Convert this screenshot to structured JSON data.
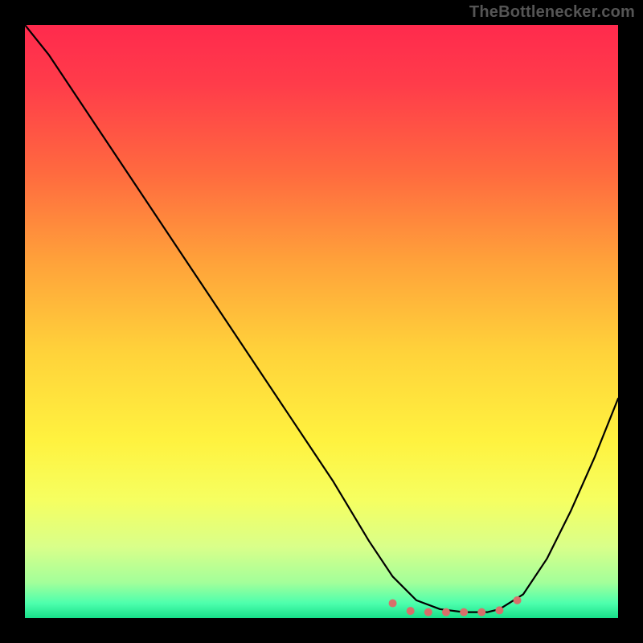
{
  "watermark": "TheBottlenecker.com",
  "chart_data": {
    "type": "line",
    "title": "",
    "xlabel": "",
    "ylabel": "",
    "xlim": [
      0,
      100
    ],
    "ylim": [
      0,
      100
    ],
    "series": [
      {
        "name": "curve",
        "x": [
          0,
          4,
          12,
          20,
          28,
          36,
          44,
          52,
          58,
          62,
          66,
          70,
          74,
          78,
          80,
          84,
          88,
          92,
          96,
          100
        ],
        "y": [
          100,
          95,
          83,
          71,
          59,
          47,
          35,
          23,
          13,
          7,
          3,
          1.5,
          1.0,
          1.0,
          1.5,
          4,
          10,
          18,
          27,
          37
        ]
      }
    ],
    "markers": {
      "name": "highlight-dots",
      "color": "#d86f6a",
      "points": [
        {
          "x": 62,
          "y": 2.5
        },
        {
          "x": 65,
          "y": 1.2
        },
        {
          "x": 68,
          "y": 1.0
        },
        {
          "x": 71,
          "y": 1.0
        },
        {
          "x": 74,
          "y": 1.0
        },
        {
          "x": 77,
          "y": 1.0
        },
        {
          "x": 80,
          "y": 1.3
        },
        {
          "x": 83,
          "y": 3.0
        }
      ]
    },
    "gradient_stops": [
      {
        "offset": 0,
        "color": "#ff2a4d"
      },
      {
        "offset": 0.1,
        "color": "#ff3c4a"
      },
      {
        "offset": 0.25,
        "color": "#ff6a3f"
      },
      {
        "offset": 0.4,
        "color": "#ffa23a"
      },
      {
        "offset": 0.55,
        "color": "#ffd23a"
      },
      {
        "offset": 0.7,
        "color": "#fff23f"
      },
      {
        "offset": 0.8,
        "color": "#f6ff60"
      },
      {
        "offset": 0.88,
        "color": "#d9ff8a"
      },
      {
        "offset": 0.94,
        "color": "#a3ff9a"
      },
      {
        "offset": 0.975,
        "color": "#4dffad"
      },
      {
        "offset": 1.0,
        "color": "#18e08a"
      }
    ]
  }
}
